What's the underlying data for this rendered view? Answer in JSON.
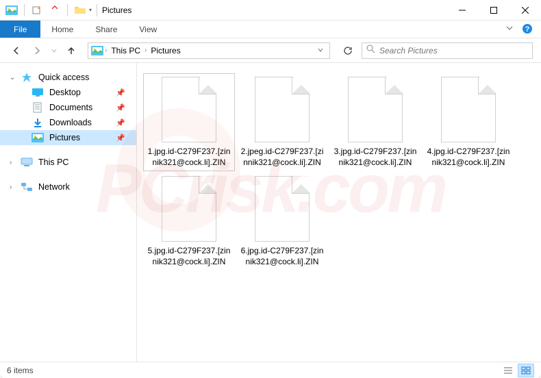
{
  "titlebar": {
    "title": "Pictures"
  },
  "ribbon": {
    "file": "File",
    "tabs": [
      "Home",
      "Share",
      "View"
    ]
  },
  "breadcrumbs": [
    "This PC",
    "Pictures"
  ],
  "search": {
    "placeholder": "Search Pictures"
  },
  "sidebar": {
    "quick_access": "Quick access",
    "items": [
      {
        "label": "Desktop",
        "icon": "desktop"
      },
      {
        "label": "Documents",
        "icon": "documents"
      },
      {
        "label": "Downloads",
        "icon": "downloads"
      },
      {
        "label": "Pictures",
        "icon": "pictures",
        "selected": true
      }
    ],
    "this_pc": "This PC",
    "network": "Network"
  },
  "files": [
    "1.jpg.id-C279F237.[zinnik321@cock.li].ZIN",
    "2.jpeg.id-C279F237.[zinnik321@cock.li].ZIN",
    "3.jpg.id-C279F237.[zinnik321@cock.li].ZIN",
    "4.jpg.id-C279F237.[zinnik321@cock.li].ZIN",
    "5.jpg.id-C279F237.[zinnik321@cock.li].ZIN",
    "6.jpg.id-C279F237.[zinnik321@cock.li].ZIN"
  ],
  "status": {
    "count": "6 items"
  }
}
